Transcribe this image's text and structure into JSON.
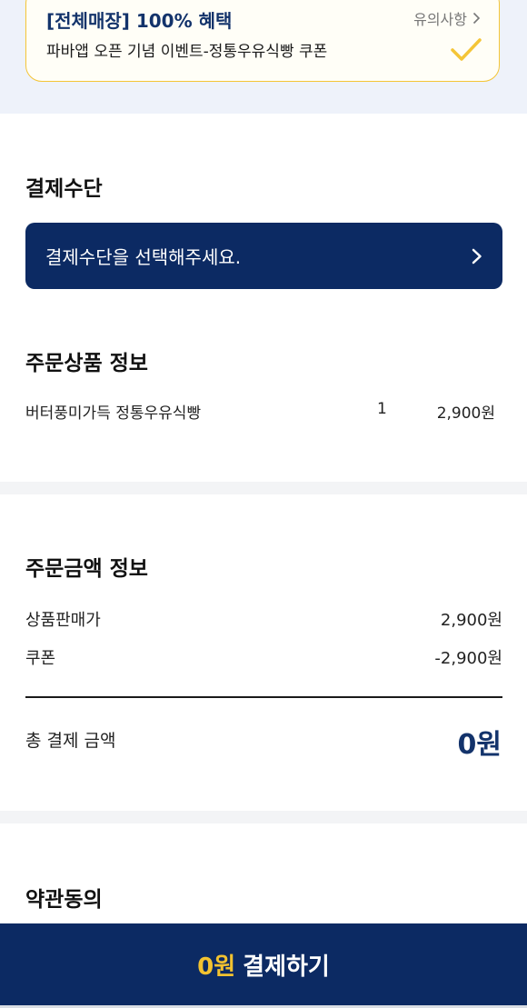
{
  "coupon": {
    "title": "[전체매장] 100% 혜택",
    "description": "파바앱 오픈 기념 이벤트-정통우유식빵 쿠폰",
    "notice_label": "유의사항",
    "accent_color": "#f4c537",
    "selected": true
  },
  "payment_method": {
    "title": "결제수단",
    "select_label": "결제수단을 선택해주세요."
  },
  "order_products": {
    "title": "주문상품 정보",
    "items": [
      {
        "name": "버터풍미가득 정통우유식빵",
        "quantity": "1",
        "price": "2,900원"
      }
    ]
  },
  "order_amount": {
    "title": "주문금액 정보",
    "rows": [
      {
        "label": "상품판매가",
        "value": "2,900원"
      },
      {
        "label": "쿠폰",
        "value": "-2,900원"
      }
    ],
    "total_label": "총 결제 금액",
    "total_value": "0원"
  },
  "terms": {
    "title": "약관동의"
  },
  "checkout": {
    "amount": "0원",
    "label": "결제하기",
    "bar_color": "#0c2a63",
    "amount_color": "#f2c230"
  }
}
